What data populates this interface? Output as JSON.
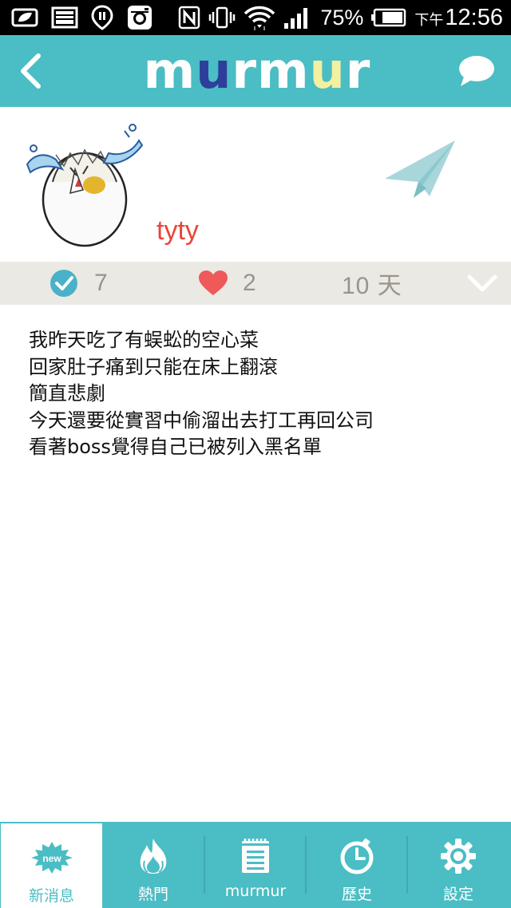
{
  "status_bar": {
    "battery_percent": "75%",
    "time_prefix": "下午",
    "time": "12:56"
  },
  "header": {
    "logo_text": "murmur",
    "logo_colors": [
      "#ffffff",
      "#2e3e9a",
      "#ffffff",
      "#ffffff",
      "#f3f0a0",
      "#ffffff"
    ]
  },
  "profile": {
    "username": "tyty"
  },
  "stats": {
    "agree_count": "7",
    "like_count": "2",
    "age": "10 天"
  },
  "message": {
    "lines": [
      "我昨天吃了有蜈蚣的空心菜",
      "回家肚子痛到只能在床上翻滾",
      "簡直悲劇",
      "今天還要從實習中偷溜出去打工再回公司",
      "看著boss覺得自己已被列入黑名單"
    ]
  },
  "bottom_nav": {
    "items": [
      {
        "label": "新消息",
        "icon": "new-badge-icon",
        "badge_text": "new",
        "active": true
      },
      {
        "label": "熱門",
        "icon": "fire-icon",
        "active": false
      },
      {
        "label": "murmur",
        "icon": "notepad-icon",
        "active": false
      },
      {
        "label": "歷史",
        "icon": "clock-icon",
        "active": false
      },
      {
        "label": "設定",
        "icon": "gear-icon",
        "active": false
      }
    ]
  },
  "colors": {
    "brand_teal": "#4bbdc4",
    "username_red": "#e9463c",
    "stats_bg": "#ebe9e3",
    "heart_red": "#ee5a5a"
  }
}
